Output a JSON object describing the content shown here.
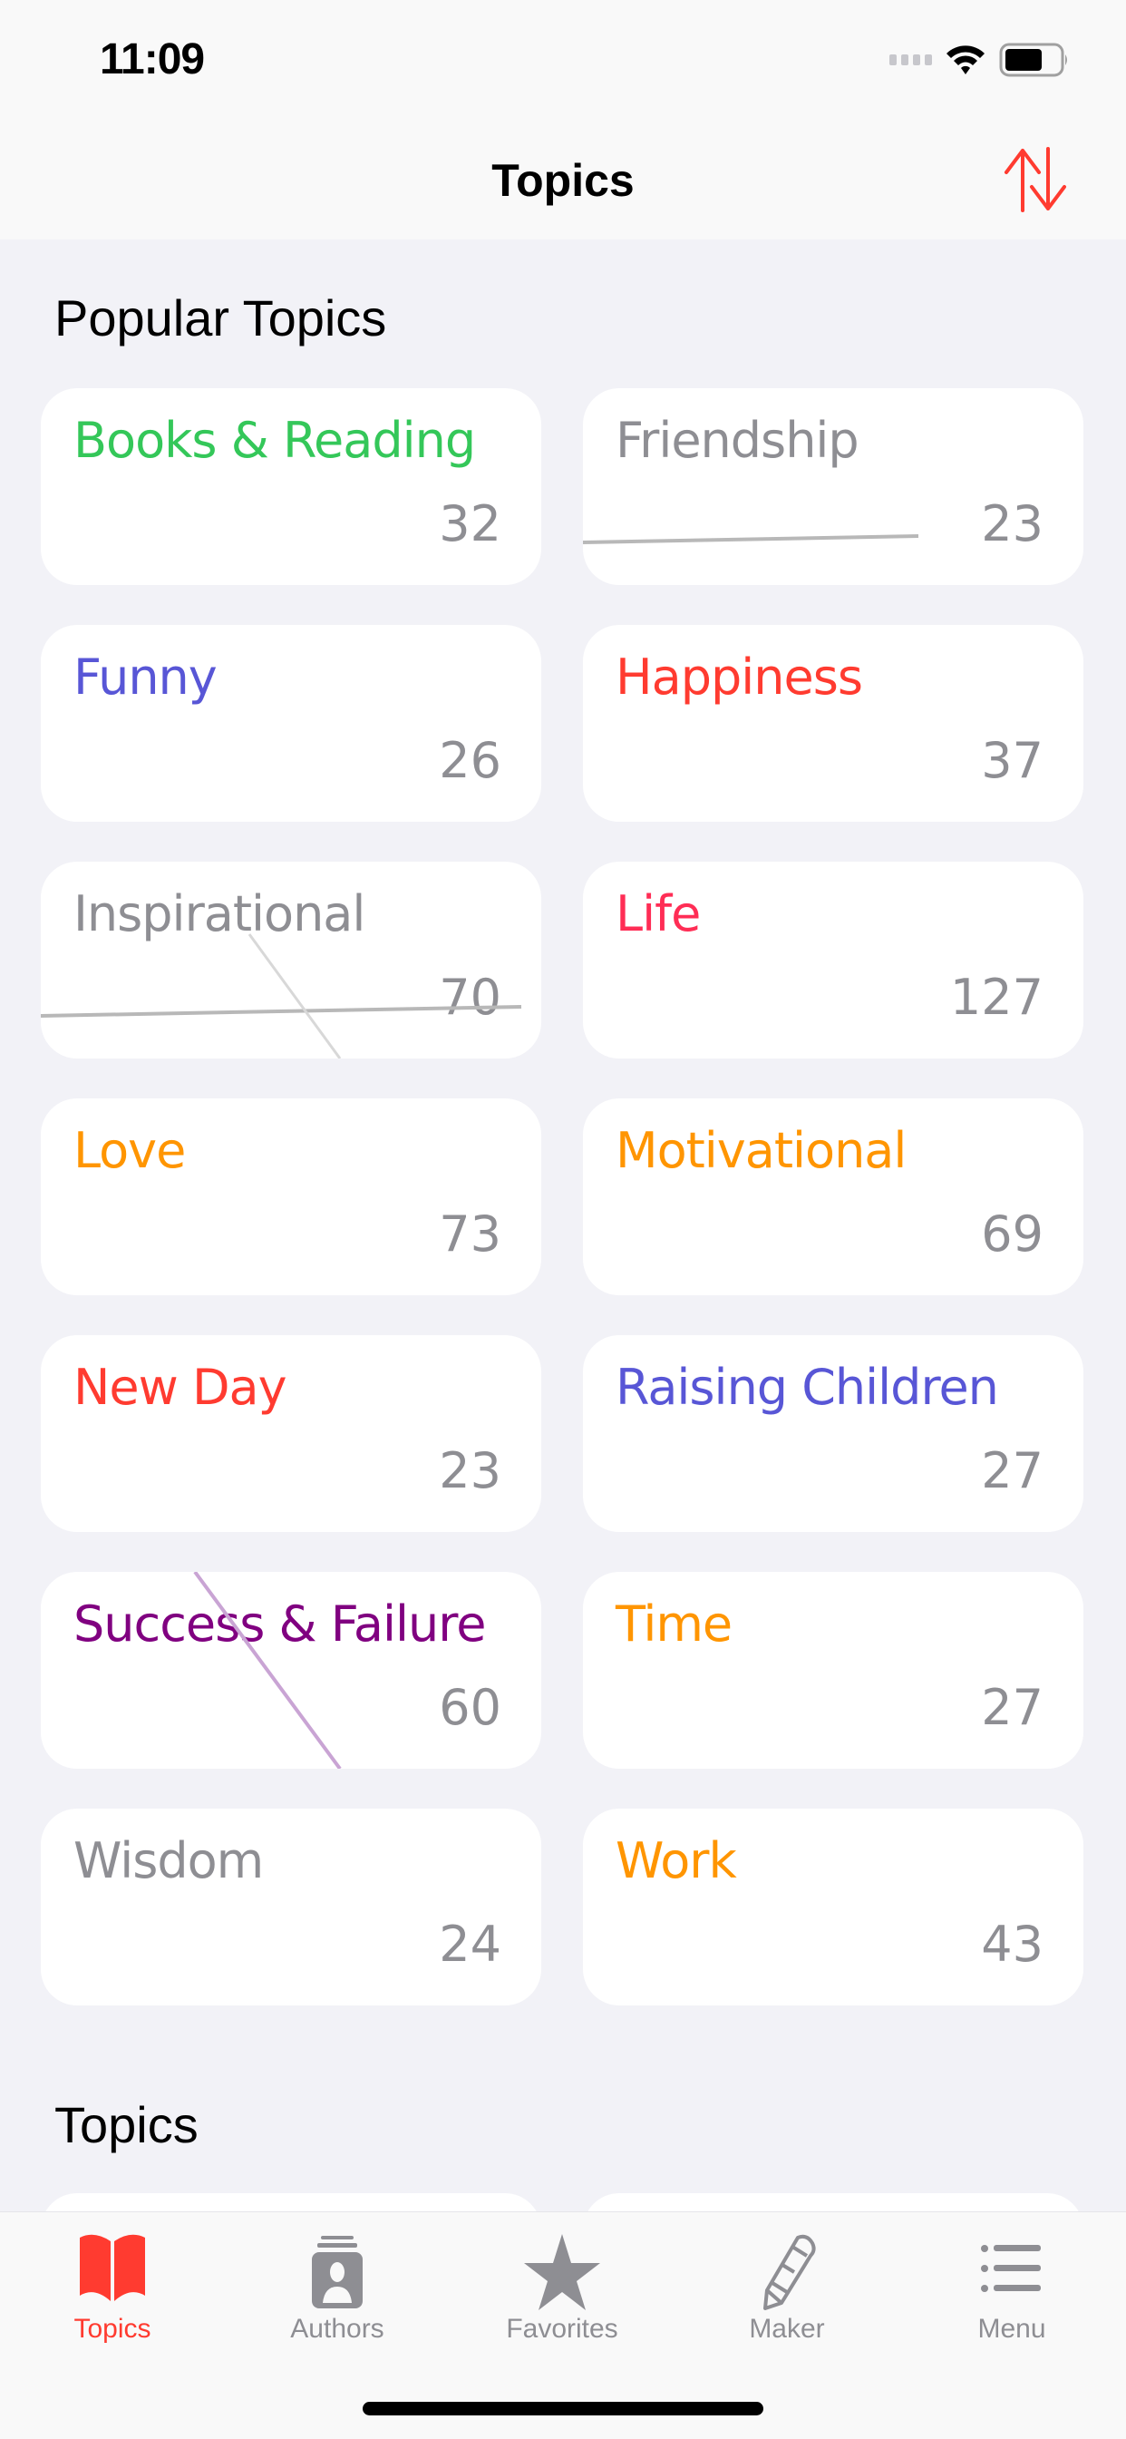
{
  "status_bar": {
    "time": "11:09"
  },
  "nav": {
    "title": "Topics",
    "sort_icon": "sort-arrows-icon"
  },
  "sections": {
    "popular_title": "Popular Topics",
    "topics_title": "Topics"
  },
  "colors": {
    "accent": "#FF3B30",
    "green": "#34C759",
    "gray": "#8E8E93",
    "indigo": "#5856D6",
    "red": "#FF3B30",
    "pink": "#FF2D55",
    "orange": "#FF9500",
    "purple": "#800080"
  },
  "popular_topics": [
    {
      "name": "Books & Reading",
      "count": "32",
      "color": "#34C759"
    },
    {
      "name": "Friendship",
      "count": "23",
      "color": "#8E8E93"
    },
    {
      "name": "Funny",
      "count": "26",
      "color": "#5856D6"
    },
    {
      "name": "Happiness",
      "count": "37",
      "color": "#FF3B30"
    },
    {
      "name": "Inspirational",
      "count": "70",
      "color": "#8E8E93"
    },
    {
      "name": "Life",
      "count": "127",
      "color": "#FF2D55"
    },
    {
      "name": "Love",
      "count": "73",
      "color": "#FF9500"
    },
    {
      "name": "Motivational",
      "count": "69",
      "color": "#FF9500"
    },
    {
      "name": "New Day",
      "count": "23",
      "color": "#FF3B30"
    },
    {
      "name": "Raising Children",
      "count": "27",
      "color": "#5856D6"
    },
    {
      "name": "Success & Failure",
      "count": "60",
      "color": "#800080"
    },
    {
      "name": "Time",
      "count": "27",
      "color": "#FF9500"
    },
    {
      "name": "Wisdom",
      "count": "24",
      "color": "#8E8E93"
    },
    {
      "name": "Work",
      "count": "43",
      "color": "#FF9500"
    }
  ],
  "tab_bar": {
    "items": [
      {
        "label": "Topics",
        "icon": "book-icon",
        "active": true
      },
      {
        "label": "Authors",
        "icon": "person-card-icon",
        "active": false
      },
      {
        "label": "Favorites",
        "icon": "star-icon",
        "active": false
      },
      {
        "label": "Maker",
        "icon": "pencil-icon",
        "active": false
      },
      {
        "label": "Menu",
        "icon": "list-icon",
        "active": false
      }
    ]
  }
}
